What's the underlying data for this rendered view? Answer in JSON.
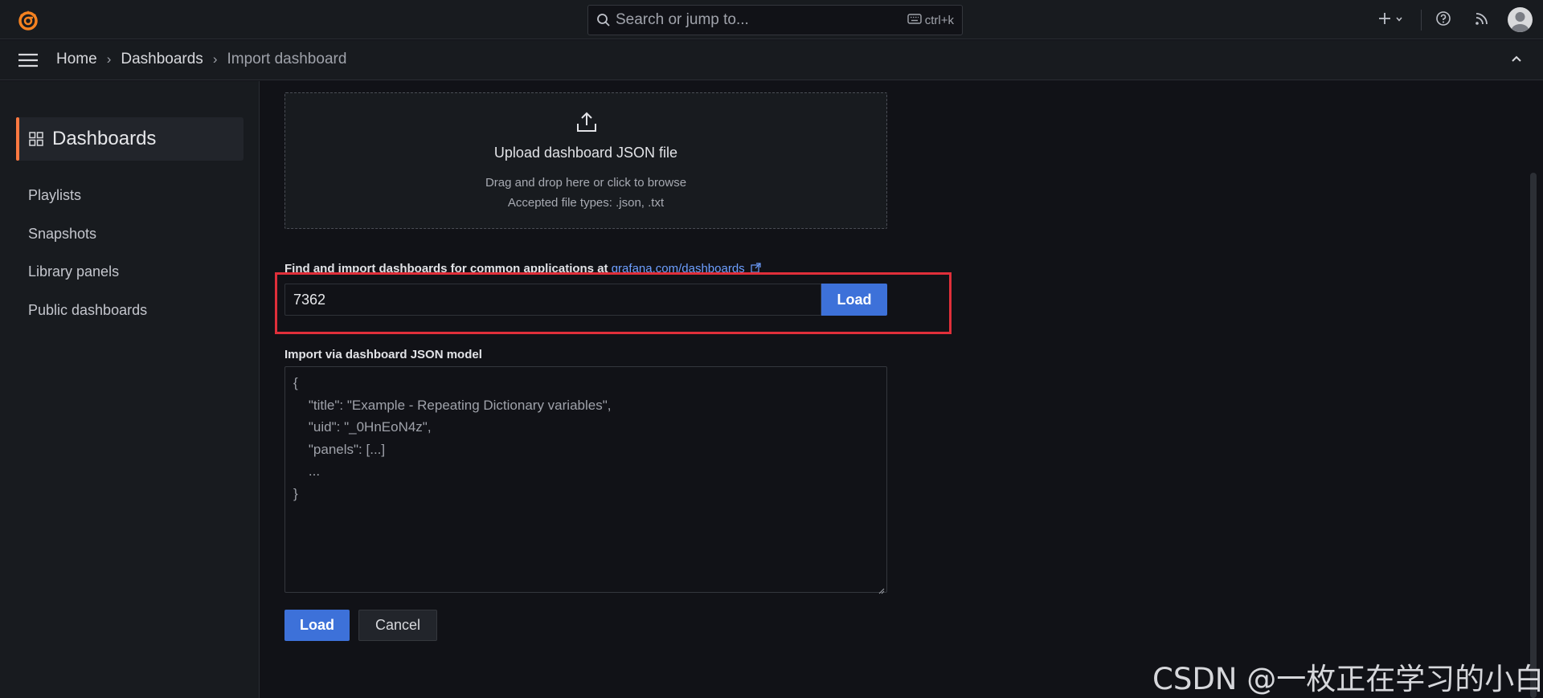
{
  "topbar": {
    "search_placeholder": "Search or jump to...",
    "search_shortcut": "ctrl+k"
  },
  "breadcrumb": {
    "items": [
      "Home",
      "Dashboards",
      "Import dashboard"
    ],
    "separator": "›"
  },
  "sidebar": {
    "section_title": "Dashboards",
    "items": [
      "Playlists",
      "Snapshots",
      "Library panels",
      "Public dashboards"
    ]
  },
  "upload": {
    "title": "Upload dashboard JSON file",
    "hint": "Drag and drop here or click to browse",
    "accepted": "Accepted file types: .json, .txt"
  },
  "grafana_import": {
    "label": "Find and import dashboards for common applications at",
    "link_text": "grafana.com/dashboards",
    "input_value": "7362",
    "load_label": "Load"
  },
  "json_model": {
    "label": "Import via dashboard JSON model",
    "placeholder_lines": [
      "{",
      "    \"title\": \"Example - Repeating Dictionary variables\",",
      "    \"uid\": \"_0HnEoN4z\",",
      "    \"panels\": [...]",
      "    ...",
      "}"
    ]
  },
  "actions": {
    "load_label": "Load",
    "cancel_label": "Cancel"
  },
  "watermark": "CSDN @一枚正在学习的小白",
  "colors": {
    "accent_orange": "#ff7941",
    "primary_blue": "#3d71d9",
    "highlight_red": "#e02f3a",
    "link_blue": "#6e9fff"
  }
}
